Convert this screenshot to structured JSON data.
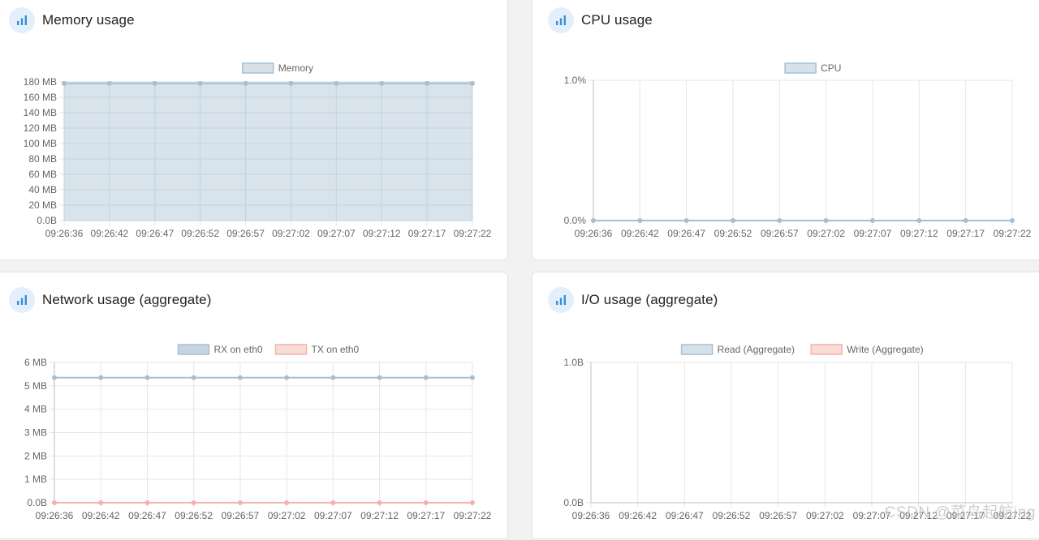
{
  "panels": {
    "memory": {
      "title": "Memory usage",
      "icon": "bar-chart-icon"
    },
    "cpu": {
      "title": "CPU usage",
      "icon": "bar-chart-icon"
    },
    "network": {
      "title": "Network usage (aggregate)",
      "icon": "bar-chart-icon"
    },
    "io": {
      "title": "I/O usage (aggregate)",
      "icon": "bar-chart-icon"
    }
  },
  "colors": {
    "blue_line": "#a7bfd3",
    "blue_fill": "#d6e1ea",
    "blue_strong_fill": "#c6d5e1",
    "red_line": "#f4b3a9",
    "red_fill": "#fadcd6",
    "icon": "#3a8fd6"
  },
  "watermark": "CSDN @菜鸟起航ing",
  "chart_data": [
    {
      "id": "memory",
      "type": "area",
      "x": [
        "09:26:36",
        "09:26:42",
        "09:26:47",
        "09:26:52",
        "09:26:57",
        "09:27:02",
        "09:27:07",
        "09:27:12",
        "09:27:17",
        "09:27:22"
      ],
      "yticks": [
        "0.0B",
        "20 MB",
        "40 MB",
        "60 MB",
        "80 MB",
        "100 MB",
        "120 MB",
        "140 MB",
        "160 MB",
        "180 MB"
      ],
      "ylim": [
        0,
        180
      ],
      "series": [
        {
          "name": "Memory",
          "values": [
            178,
            178,
            178,
            178,
            178,
            178,
            178,
            178,
            178,
            178
          ]
        }
      ],
      "grid": true,
      "legend": "top-center"
    },
    {
      "id": "cpu",
      "type": "line",
      "x": [
        "09:26:36",
        "09:26:42",
        "09:26:47",
        "09:26:52",
        "09:26:57",
        "09:27:02",
        "09:27:07",
        "09:27:12",
        "09:27:17",
        "09:27:22"
      ],
      "yticks": [
        "0.0%",
        "1.0%"
      ],
      "ylim": [
        0,
        1
      ],
      "series": [
        {
          "name": "CPU",
          "values": [
            0,
            0,
            0,
            0,
            0,
            0,
            0,
            0,
            0,
            0
          ]
        }
      ],
      "grid": true,
      "legend": "top-center"
    },
    {
      "id": "network",
      "type": "line",
      "x": [
        "09:26:36",
        "09:26:42",
        "09:26:47",
        "09:26:52",
        "09:26:57",
        "09:27:02",
        "09:27:07",
        "09:27:12",
        "09:27:17",
        "09:27:22"
      ],
      "yticks": [
        "0.0B",
        "1 MB",
        "2 MB",
        "3 MB",
        "4 MB",
        "5 MB",
        "6 MB"
      ],
      "ylim": [
        0,
        6
      ],
      "series": [
        {
          "name": "RX on eth0",
          "values": [
            5.35,
            5.35,
            5.35,
            5.35,
            5.35,
            5.35,
            5.35,
            5.35,
            5.35,
            5.35
          ]
        },
        {
          "name": "TX on eth0",
          "values": [
            0,
            0,
            0,
            0,
            0,
            0,
            0,
            0,
            0,
            0
          ]
        }
      ],
      "grid": true,
      "legend": "top-center"
    },
    {
      "id": "io",
      "type": "line",
      "x": [
        "09:26:36",
        "09:26:42",
        "09:26:47",
        "09:26:52",
        "09:26:57",
        "09:27:02",
        "09:27:07",
        "09:27:12",
        "09:27:17",
        "09:27:22"
      ],
      "yticks": [
        "0.0B",
        "1.0B"
      ],
      "ylim": [
        0,
        1
      ],
      "series": [
        {
          "name": "Read (Aggregate)",
          "values": []
        },
        {
          "name": "Write (Aggregate)",
          "values": []
        }
      ],
      "grid": true,
      "legend": "top-center"
    }
  ]
}
